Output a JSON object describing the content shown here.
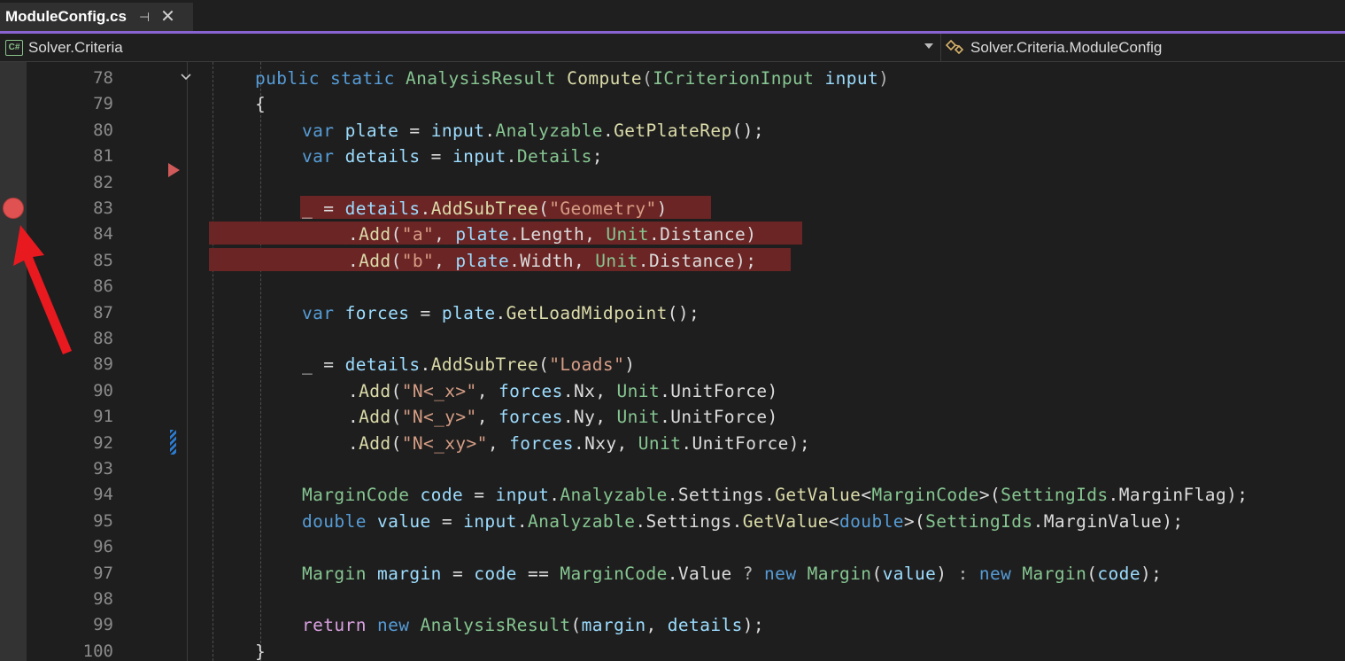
{
  "tab": {
    "title": "ModuleConfig.cs",
    "pin_icon": "pin-icon",
    "close_icon": "close-icon"
  },
  "navbar": {
    "project_icon": "csharp-project-icon",
    "project": "Solver.Criteria",
    "member_icon": "class-icon",
    "member": "Solver.Criteria.ModuleConfig"
  },
  "editor": {
    "breakpoint_line": 83,
    "highlight_color": "#6c2525",
    "lines": [
      {
        "n": "78"
      },
      {
        "n": "79"
      },
      {
        "n": "80"
      },
      {
        "n": "81"
      },
      {
        "n": "82"
      },
      {
        "n": "83"
      },
      {
        "n": "84"
      },
      {
        "n": "85"
      },
      {
        "n": "86"
      },
      {
        "n": "87"
      },
      {
        "n": "88"
      },
      {
        "n": "89"
      },
      {
        "n": "90"
      },
      {
        "n": "91"
      },
      {
        "n": "92"
      },
      {
        "n": "93"
      },
      {
        "n": "94"
      },
      {
        "n": "95"
      },
      {
        "n": "96"
      },
      {
        "n": "97"
      },
      {
        "n": "98"
      },
      {
        "n": "99"
      },
      {
        "n": "100"
      }
    ]
  },
  "code": {
    "l78": [
      "public",
      " ",
      "static",
      " ",
      "AnalysisResult",
      " ",
      "Compute",
      "(",
      "ICriterionInput",
      " ",
      "input",
      ")"
    ],
    "l79": [
      "{"
    ],
    "l80": [
      "var",
      " ",
      "plate",
      " = ",
      "input",
      ".",
      "Analyzable",
      ".",
      "GetPlateRep",
      "();"
    ],
    "l81": [
      "var",
      " ",
      "details",
      " = ",
      "input",
      ".",
      "Details",
      ";"
    ],
    "l83": [
      "_ = ",
      "details",
      ".",
      "AddSubTree",
      "(",
      "\"Geometry\"",
      ")"
    ],
    "l84": [
      ".",
      "Add",
      "(",
      "\"a\"",
      ", ",
      "plate",
      ".",
      "Length",
      ", ",
      "Unit",
      ".",
      "Distance",
      ")"
    ],
    "l85": [
      ".",
      "Add",
      "(",
      "\"b\"",
      ", ",
      "plate",
      ".",
      "Width",
      ", ",
      "Unit",
      ".",
      "Distance",
      ");"
    ],
    "l87": [
      "var",
      " ",
      "forces",
      " = ",
      "plate",
      ".",
      "GetLoadMidpoint",
      "();"
    ],
    "l89": [
      "_ = ",
      "details",
      ".",
      "AddSubTree",
      "(",
      "\"Loads\"",
      ")"
    ],
    "l90": [
      ".",
      "Add",
      "(",
      "\"N<_x>\"",
      ", ",
      "forces",
      ".",
      "Nx",
      ", ",
      "Unit",
      ".",
      "UnitForce",
      ")"
    ],
    "l91": [
      ".",
      "Add",
      "(",
      "\"N<_y>\"",
      ", ",
      "forces",
      ".",
      "Ny",
      ", ",
      "Unit",
      ".",
      "UnitForce",
      ")"
    ],
    "l92": [
      ".",
      "Add",
      "(",
      "\"N<_xy>\"",
      ", ",
      "forces",
      ".",
      "Nxy",
      ", ",
      "Unit",
      ".",
      "UnitForce",
      ");"
    ],
    "l94": [
      "MarginCode",
      " ",
      "code",
      " = ",
      "input",
      ".",
      "Analyzable",
      ".",
      "Settings",
      ".",
      "GetValue",
      "<",
      "MarginCode",
      ">(",
      "SettingIds",
      ".",
      "MarginFlag",
      ");"
    ],
    "l95": [
      "double",
      " ",
      "value",
      " = ",
      "input",
      ".",
      "Analyzable",
      ".",
      "Settings",
      ".",
      "GetValue",
      "<",
      "double",
      ">(",
      "SettingIds",
      ".",
      "MarginValue",
      ");"
    ],
    "l97": [
      "Margin",
      " ",
      "margin",
      " = ",
      "code",
      " == ",
      "MarginCode",
      ".",
      "Value",
      " ? ",
      "new",
      " ",
      "Margin",
      "(",
      "value",
      ") ",
      ":",
      " ",
      "new",
      " ",
      "Margin",
      "(",
      "code",
      ");"
    ],
    "l99": [
      "return",
      " ",
      "new",
      " ",
      "AnalysisResult",
      "(",
      "margin",
      ", ",
      "details",
      ");"
    ],
    "l100": [
      "}"
    ]
  }
}
